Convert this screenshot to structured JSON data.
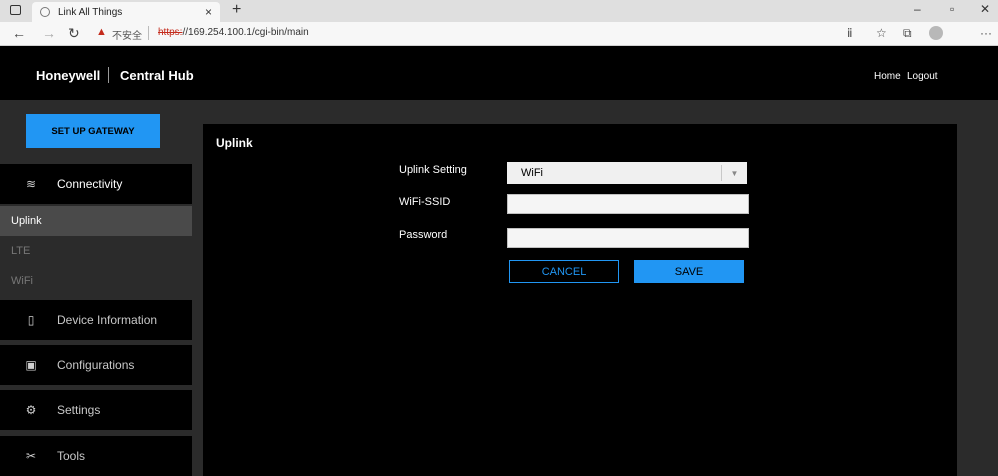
{
  "browser": {
    "tab_title": "Link All Things",
    "tab_close": "×",
    "new_tab": "+",
    "security_label": "不安全",
    "url_protocol": "https:",
    "url_rest": "//169.254.100.1/cgi-bin/main"
  },
  "header": {
    "brand": "Honeywell",
    "product": "Central Hub",
    "home_link": "Home",
    "logout_link": "Logout"
  },
  "sidebar": {
    "setup_button": "SET UP GATEWAY",
    "connectivity": "Connectivity",
    "sub_items": [
      "Uplink",
      "LTE",
      "WiFi"
    ],
    "device_information": "Device Information",
    "configurations": "Configurations",
    "settings": "Settings",
    "tools": "Tools"
  },
  "content": {
    "title": "Uplink",
    "uplink_setting_label": "Uplink Setting",
    "uplink_setting_value": "WiFi",
    "wifi_ssid_label": "WiFi-SSID",
    "wifi_ssid_value": "",
    "password_label": "Password",
    "password_value": "",
    "cancel_button": "CANCEL",
    "save_button": "SAVE"
  },
  "colors": {
    "accent": "#2196f3",
    "header_bg": "#000000",
    "page_bg": "#2b2b2b",
    "warning": "#c42b1c"
  }
}
